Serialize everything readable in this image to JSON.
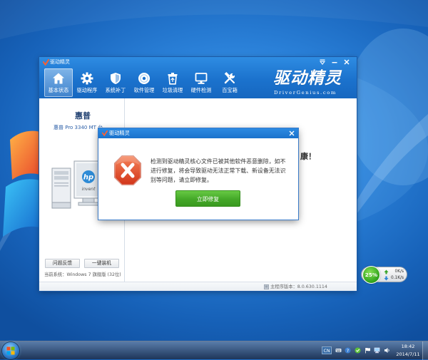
{
  "desktop": {
    "taskbar": {
      "start_icon": "windows-logo-icon",
      "language": "CN",
      "tray_icons": [
        "ime-keyboard-icon",
        "ime-help-icon",
        "app-tray-icon",
        "action-center-flag-icon",
        "network-icon",
        "volume-icon"
      ],
      "time": "18:42",
      "date": "2014/7/11"
    },
    "net_widget": {
      "percent": "25%",
      "upload": "0K/s",
      "download": "0.1K/s",
      "upload_icon": "up-arrow-icon",
      "download_icon": "down-arrow-icon"
    }
  },
  "app": {
    "title": "驱动精灵",
    "title_controls": [
      "menu-dropdown-icon",
      "minimize-icon",
      "close-icon"
    ],
    "toolbar": {
      "items": [
        {
          "label": "基本状态",
          "icon": "home-icon",
          "active": true
        },
        {
          "label": "驱动程序",
          "icon": "gear-icon"
        },
        {
          "label": "系统补丁",
          "icon": "shield-icon"
        },
        {
          "label": "软件管理",
          "icon": "disc-icon"
        },
        {
          "label": "垃圾清理",
          "icon": "trash-icon"
        },
        {
          "label": "硬件检测",
          "icon": "monitor-icon"
        },
        {
          "label": "百宝箱",
          "icon": "tools-icon"
        }
      ]
    },
    "logo": {
      "name": "驱动精灵",
      "site": "DriverGenius.com"
    },
    "left_panel": {
      "brand": "惠普",
      "model": "惠普 Pro 3340 MT 台",
      "device_image": {
        "logo": "hp",
        "tagline": "invent"
      },
      "buttons": [
        "问题反馈",
        "一键装机"
      ],
      "system": "当前系统：Windows 7 旗舰版 (32位)"
    },
    "main_panel": {
      "headline_partial": "康！"
    },
    "status_bar": {
      "icon": "info-icon",
      "version": "主程序版本：8.0.630.1114"
    }
  },
  "dialog": {
    "title": "驱动精灵",
    "icon": "error-x-icon",
    "message_lines": [
      "检测到驱动精灵核心文件已被其他软件恶意删除，如不",
      "进行修复，将会导致驱动无法正常下载、新设备无法识",
      "别等问题，请立即修复。"
    ],
    "primary_button": "立即修复"
  },
  "colors": {
    "app_blue": "#1b72cd",
    "dialog_title_blue": "#1a72cc",
    "button_green": "#44a828",
    "error_red": "#d9401f",
    "net_green": "#34a61e"
  }
}
